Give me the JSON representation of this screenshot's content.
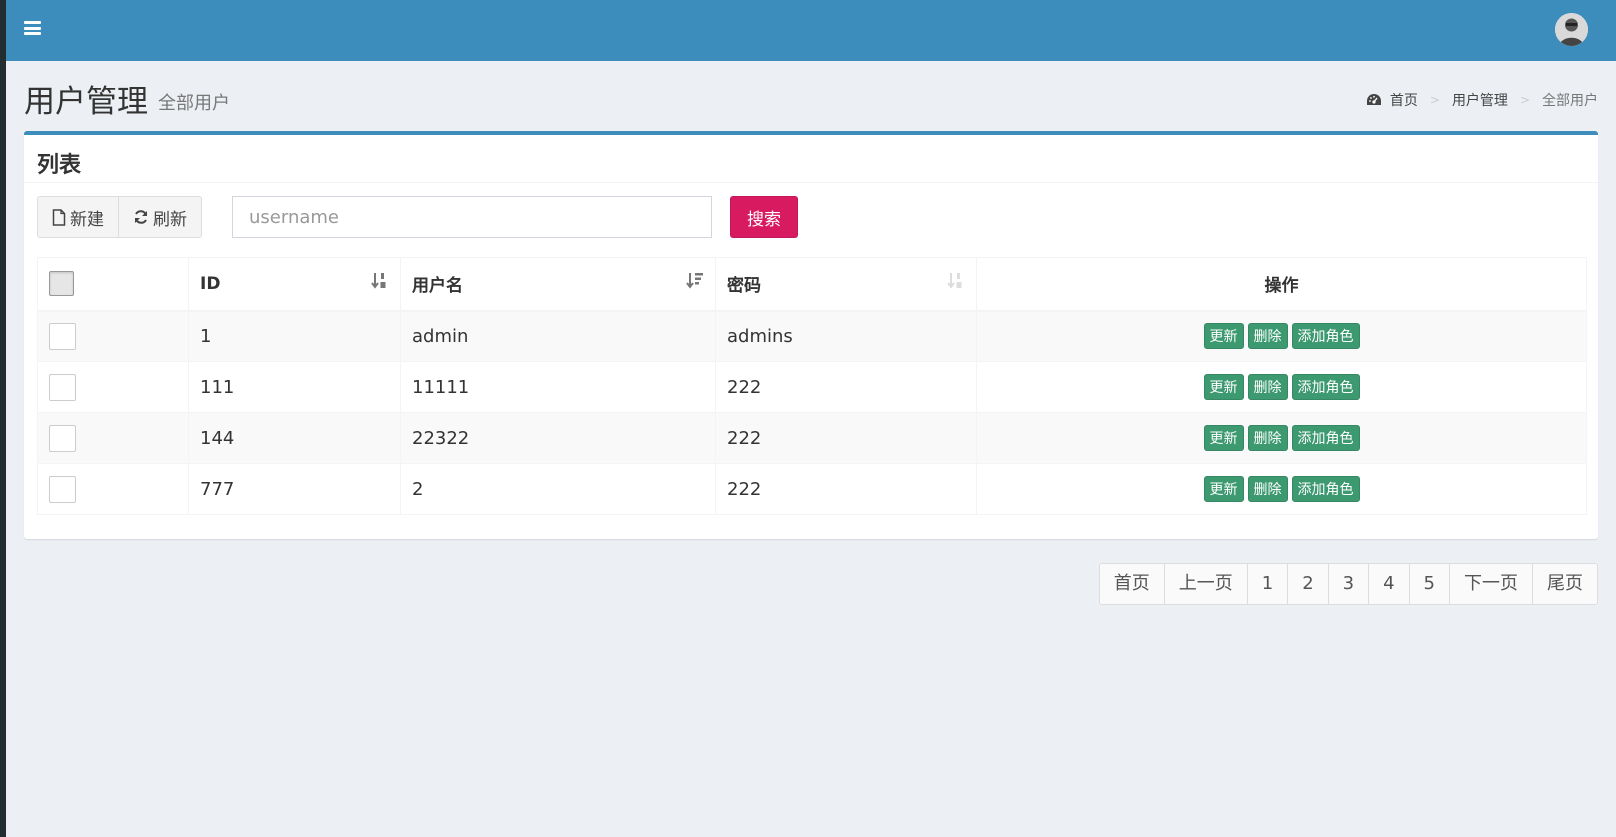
{
  "header": {
    "menu_icon": "hamburger-icon",
    "avatar": "user-avatar"
  },
  "content_header": {
    "title": "用户管理",
    "subtitle": "全部用户"
  },
  "breadcrumb": {
    "icon": "dashboard-icon",
    "items": [
      "首页",
      "用户管理",
      "全部用户"
    ],
    "separator": ">"
  },
  "box": {
    "title": "列表"
  },
  "toolbar": {
    "new_label": "新建",
    "refresh_label": "刷新",
    "search_placeholder": "username",
    "search_value": "",
    "search_button": "搜索"
  },
  "table": {
    "columns": [
      "ID",
      "用户名",
      "密码",
      "操作"
    ],
    "rows": [
      {
        "id": "1",
        "username": "admin",
        "password": "admins"
      },
      {
        "id": "111",
        "username": "11111",
        "password": "222"
      },
      {
        "id": "144",
        "username": "22322",
        "password": "222"
      },
      {
        "id": "777",
        "username": "2",
        "password": "222"
      }
    ],
    "row_actions": [
      "更新",
      "删除",
      "添加角色"
    ]
  },
  "pagination": {
    "first": "首页",
    "prev": "上一页",
    "pages": [
      "1",
      "2",
      "3",
      "4",
      "5"
    ],
    "next": "下一页",
    "last": "尾页"
  },
  "colors": {
    "topbar": "#3c8dbc",
    "search_button": "#d81b60",
    "action_button": "#3d9970",
    "background": "#ecf0f5"
  }
}
